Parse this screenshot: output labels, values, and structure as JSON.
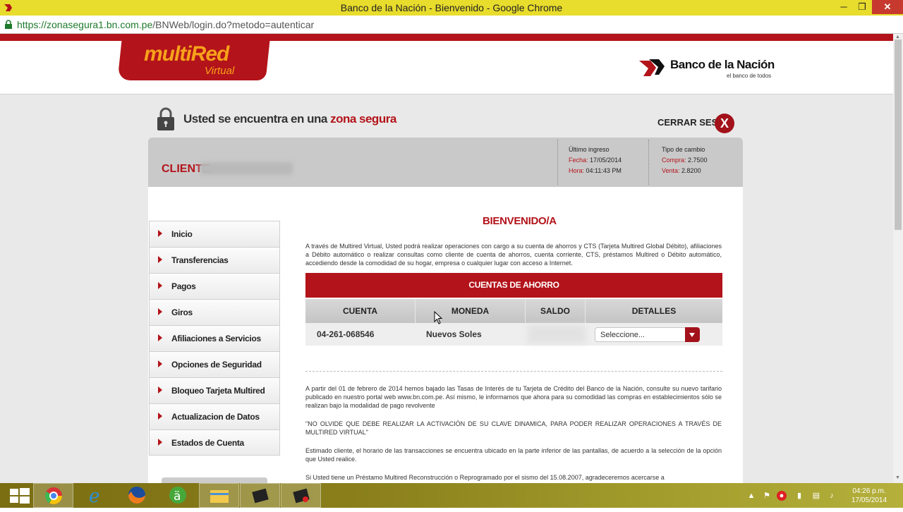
{
  "browser": {
    "title": "Banco de la Nación - Bienvenido - Google Chrome",
    "url_host": "https://zonasegura1.bn.com.pe",
    "url_path": "/BNWeb/login.do?metodo=autenticar",
    "min_label": "─",
    "max_label": "❐",
    "close_label": "✕"
  },
  "brand": {
    "logo_main": "multiRed",
    "logo_sub": "Virtual",
    "bank_name": "Banco de la Nación",
    "bank_tagline": "el banco de todos"
  },
  "secure": {
    "text_prefix": "Usted se encuentra en una ",
    "text_highlight": "zona segura"
  },
  "logout": {
    "label": "CERRAR SESIÓN",
    "icon": "X"
  },
  "client": {
    "label": "CLIENTE:",
    "last_login_title": "Último ingreso",
    "date_label": "Fecha:",
    "date_value": "17/05/2014",
    "time_label": "Hora:",
    "time_value": "04:11:43 PM",
    "exchange_title": "Tipo de cambio",
    "buy_label": "Compra:",
    "buy_value": "2.7500",
    "sell_label": "Venta:",
    "sell_value": "2.8200"
  },
  "menu": [
    {
      "label": "Inicio"
    },
    {
      "label": "Transferencias"
    },
    {
      "label": "Pagos"
    },
    {
      "label": "Giros"
    },
    {
      "label": "Afiliaciones a Servicios"
    },
    {
      "label": "Opciones de Seguridad"
    },
    {
      "label": "Bloqueo Tarjeta Multired"
    },
    {
      "label": "Actualizacion de Datos"
    },
    {
      "label": "Estados de Cuenta"
    }
  ],
  "main": {
    "welcome": "BIENVENIDO/A",
    "intro": "A través de Multired Virtual, Usted podrá realizar operaciones con cargo a su cuenta de ahorros y CTS (Tarjeta Multired Global Débito), afiliaciones a Débito automático o realizar consultas como cliente de cuenta de ahorros, cuenta corriente, CTS, préstamos Multired o Débito automático, accediendo desde la comodidad de su hogar, empresa o cualquier lugar con acceso a Internet.",
    "accounts_title": "CUENTAS DE AHORRO",
    "columns": [
      "CUENTA",
      "MONEDA",
      "SALDO",
      "DETALLES"
    ],
    "row": {
      "account": "04-261-068546",
      "currency": "Nuevos Soles",
      "select_placeholder": "Seleccione..."
    },
    "notice1": "A partir del 01 de febrero de 2014 hemos bajado las Tasas de Interés de tu Tarjeta de Crédito del Banco de la Nación, consulte su nuevo tarifario publicado en nuestro portal web www.bn.com.pe. Así mismo, le informamos que ahora para su comodidad las compras en establecimientos sólo se realizan bajo la modalidad de pago revolvente",
    "notice2": "\"NO OLVIDE QUE DEBE REALIZAR LA ACTIVACIÓN DE SU CLAVE DINAMICA, PARA PODER REALIZAR OPERACIONES A TRAVÉS DE MULTIRED VIRTUAL\"",
    "notice3": "Estimado cliente, el horario de las transacciones se encuentra ubicado en la parte inferior de las pantallas, de acuerdo a la selección de la opción que Usted realice.",
    "notice4": "Si Usted tiene un Préstamo Multired Reconstrucción o Reprogramado por el sismo del 15.08.2007, agradeceremos acercarse a"
  },
  "taskbar": {
    "clock_time": "04:26 p.m.",
    "clock_date": "17/05/2014"
  },
  "colors": {
    "brand_red": "#b3131a",
    "logo_orange": "#f7a21b"
  }
}
